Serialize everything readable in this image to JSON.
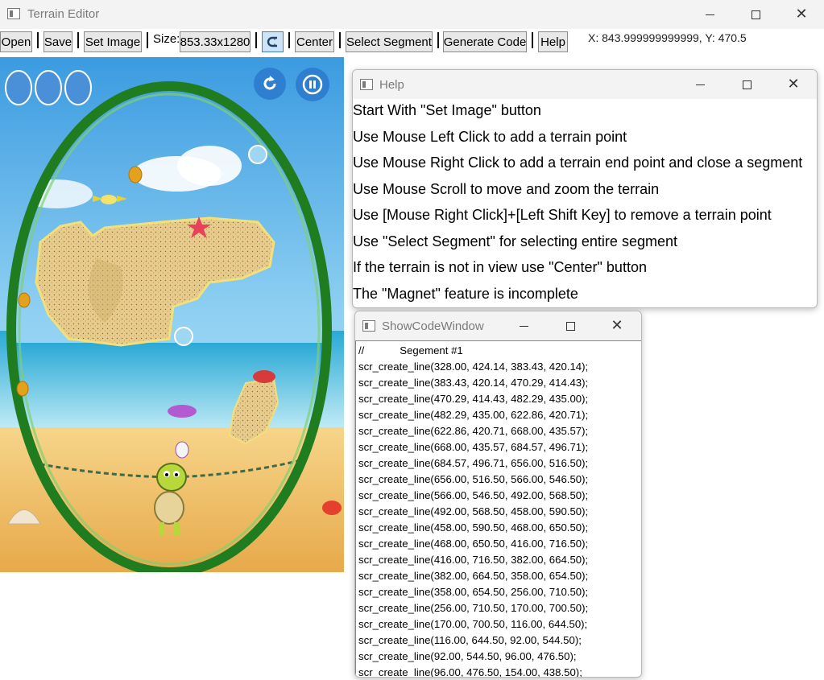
{
  "window": {
    "title": "Terrain Editor",
    "icon": "window-icon"
  },
  "toolbar": {
    "open": "Open",
    "save": "Save",
    "set_image": "Set Image",
    "size_label": "Size:",
    "size_value": "853.33x1280",
    "magnet_icon": "magnet-icon",
    "center": "Center",
    "select_segment": "Select Segment",
    "generate_code": "Generate Code",
    "help": "Help",
    "coords": "X: 843.999999999999, Y: 470.5"
  },
  "help": {
    "title": "Help",
    "lines": [
      "Start With \"Set Image\" button",
      "Use Mouse Left Click to add a terrain point",
      "Use Mouse Right Click to add a terrain end point and close a segment",
      "Use Mouse Scroll to move and zoom the terrain",
      "Use [Mouse Right Click]+[Left Shift Key] to remove a terrain point",
      "Use \"Select Segment\" for selecting entire segment",
      "If the terrain is not in view use \"Center\" button",
      "The \"Magnet\" feature is incomplete"
    ]
  },
  "code_window": {
    "title": "ShowCodeWindow",
    "lines": [
      "//            Segement #1",
      "scr_create_line(328.00, 424.14, 383.43, 420.14);",
      "scr_create_line(383.43, 420.14, 470.29, 414.43);",
      "scr_create_line(470.29, 414.43, 482.29, 435.00);",
      "scr_create_line(482.29, 435.00, 622.86, 420.71);",
      "scr_create_line(622.86, 420.71, 668.00, 435.57);",
      "scr_create_line(668.00, 435.57, 684.57, 496.71);",
      "scr_create_line(684.57, 496.71, 656.00, 516.50);",
      "scr_create_line(656.00, 516.50, 566.00, 546.50);",
      "scr_create_line(566.00, 546.50, 492.00, 568.50);",
      "scr_create_line(492.00, 568.50, 458.00, 590.50);",
      "scr_create_line(458.00, 590.50, 468.00, 650.50);",
      "scr_create_line(468.00, 650.50, 416.00, 716.50);",
      "scr_create_line(416.00, 716.50, 382.00, 664.50);",
      "scr_create_line(382.00, 664.50, 358.00, 654.50);",
      "scr_create_line(358.00, 654.50, 256.00, 710.50);",
      "scr_create_line(256.00, 710.50, 170.00, 700.50);",
      "scr_create_line(170.00, 700.50, 116.00, 644.50);",
      "scr_create_line(116.00, 644.50, 92.00, 544.50);",
      "scr_create_line(92.00, 544.50, 96.00, 476.50);",
      "scr_create_line(96.00, 476.50, 154.00, 438.50);"
    ]
  },
  "canvas": {
    "icons": [
      "restart-icon",
      "pause-icon",
      "turtle-character",
      "egg-icon",
      "crab-icon"
    ]
  },
  "colors": {
    "sky": "#4fa9e0",
    "sea": "#3fb6d8",
    "sand": "#e8cf8f",
    "egg_border": "#1f7d1f",
    "accent": "#3d7fc1"
  }
}
